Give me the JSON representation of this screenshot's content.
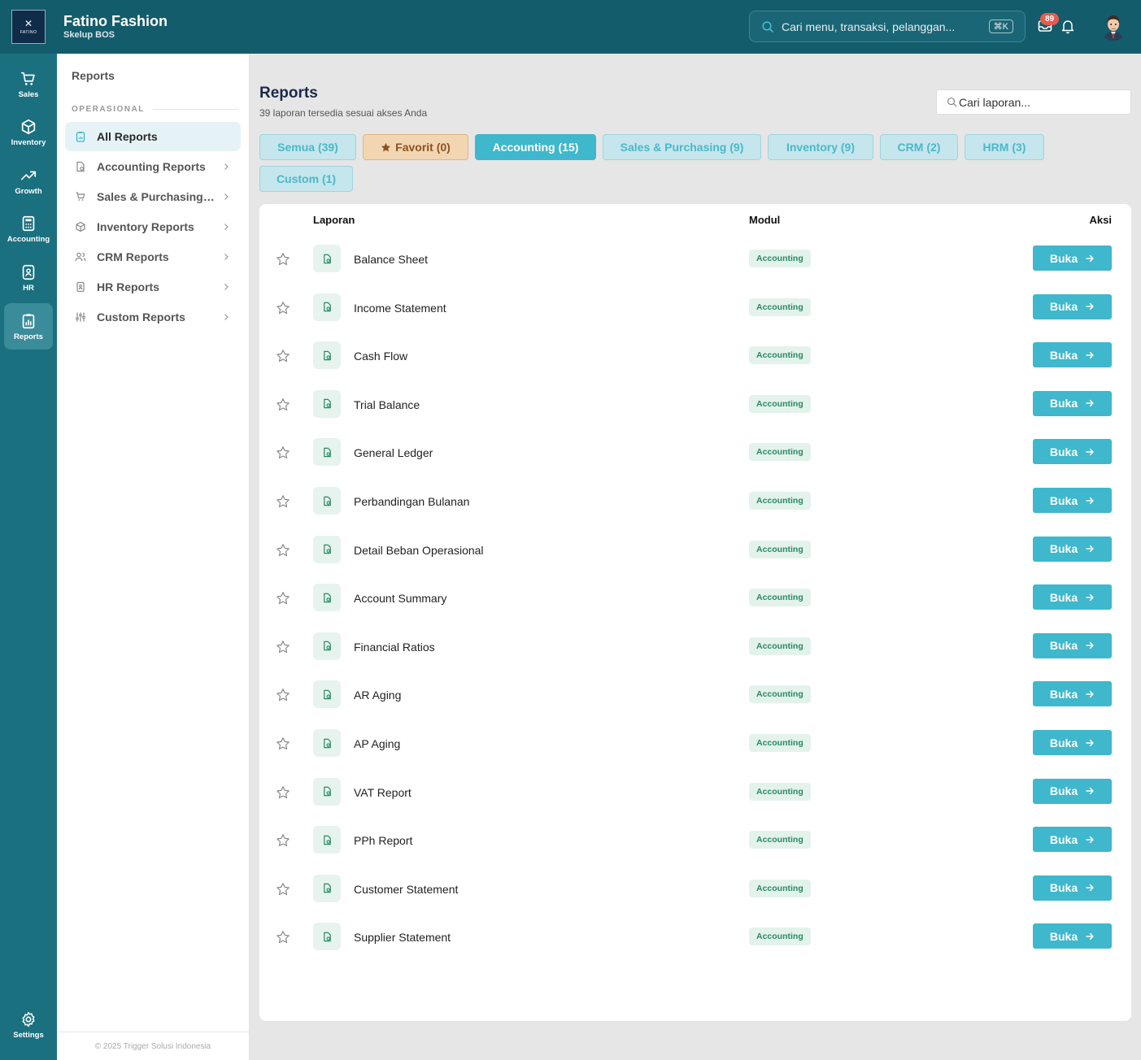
{
  "header": {
    "logo_text": "FATINO",
    "brand_name": "Fatino Fashion",
    "brand_sub": "Skelup BOS",
    "search_placeholder": "Cari menu, transaksi, pelanggan...",
    "search_shortcut": "⌘K",
    "notification_count": "89"
  },
  "rail": [
    {
      "label": "Sales",
      "icon": "cart-icon"
    },
    {
      "label": "Inventory",
      "icon": "box-icon"
    },
    {
      "label": "Growth",
      "icon": "trending-up-icon"
    },
    {
      "label": "Accounting",
      "icon": "calculator-icon"
    },
    {
      "label": "HR",
      "icon": "id-badge-icon"
    },
    {
      "label": "Reports",
      "icon": "clipboard-chart-icon"
    }
  ],
  "rail_settings": {
    "label": "Settings",
    "icon": "gear-icon"
  },
  "sidebar": {
    "title": "Reports",
    "section": "OPERASIONAL",
    "items": [
      {
        "label": "All Reports",
        "icon": "clipboard-icon"
      },
      {
        "label": "Accounting Reports",
        "icon": "file-icon"
      },
      {
        "label": "Sales & Purchasing Reports",
        "icon": "cart-icon"
      },
      {
        "label": "Inventory Reports",
        "icon": "box-icon"
      },
      {
        "label": "CRM Reports",
        "icon": "users-icon"
      },
      {
        "label": "HR Reports",
        "icon": "id-badge-icon"
      },
      {
        "label": "Custom Reports",
        "icon": "sliders-icon"
      }
    ],
    "footer": "© 2025 Trigger Solusi Indonesia"
  },
  "main": {
    "title": "Reports",
    "subtitle": "39 laporan tersedia sesuai akses Anda",
    "search_placeholder": "Cari laporan...",
    "filters": [
      {
        "label": "Semua (39)"
      },
      {
        "label": "Favorit (0)"
      },
      {
        "label": "Accounting (15)"
      },
      {
        "label": "Sales & Purchasing (9)"
      },
      {
        "label": "Inventory (9)"
      },
      {
        "label": "CRM (2)"
      },
      {
        "label": "HRM (3)"
      },
      {
        "label": "Custom (1)"
      }
    ],
    "active_filter": "Accounting (15)",
    "table": {
      "headers": {
        "report": "Laporan",
        "module": "Modul",
        "action": "Aksi"
      },
      "open_label": "Buka",
      "rows": [
        {
          "name": "Balance Sheet",
          "module": "Accounting"
        },
        {
          "name": "Income Statement",
          "module": "Accounting"
        },
        {
          "name": "Cash Flow",
          "module": "Accounting"
        },
        {
          "name": "Trial Balance",
          "module": "Accounting"
        },
        {
          "name": "General Ledger",
          "module": "Accounting"
        },
        {
          "name": "Perbandingan Bulanan",
          "module": "Accounting"
        },
        {
          "name": "Detail Beban Operasional",
          "module": "Accounting"
        },
        {
          "name": "Account Summary",
          "module": "Accounting"
        },
        {
          "name": "Financial Ratios",
          "module": "Accounting"
        },
        {
          "name": "AR Aging",
          "module": "Accounting"
        },
        {
          "name": "AP Aging",
          "module": "Accounting"
        },
        {
          "name": "VAT Report",
          "module": "Accounting"
        },
        {
          "name": "PPh Report",
          "module": "Accounting"
        },
        {
          "name": "Customer Statement",
          "module": "Accounting"
        },
        {
          "name": "Supplier Statement",
          "module": "Accounting"
        }
      ]
    }
  },
  "colors": {
    "header_bg": "#135c6b",
    "rail_bg": "#1b7080",
    "accent": "#3fb7cc",
    "favorite_bg": "#f2d5b1",
    "module_badge": "#e3f3ec",
    "notification": "#e85a4f"
  }
}
